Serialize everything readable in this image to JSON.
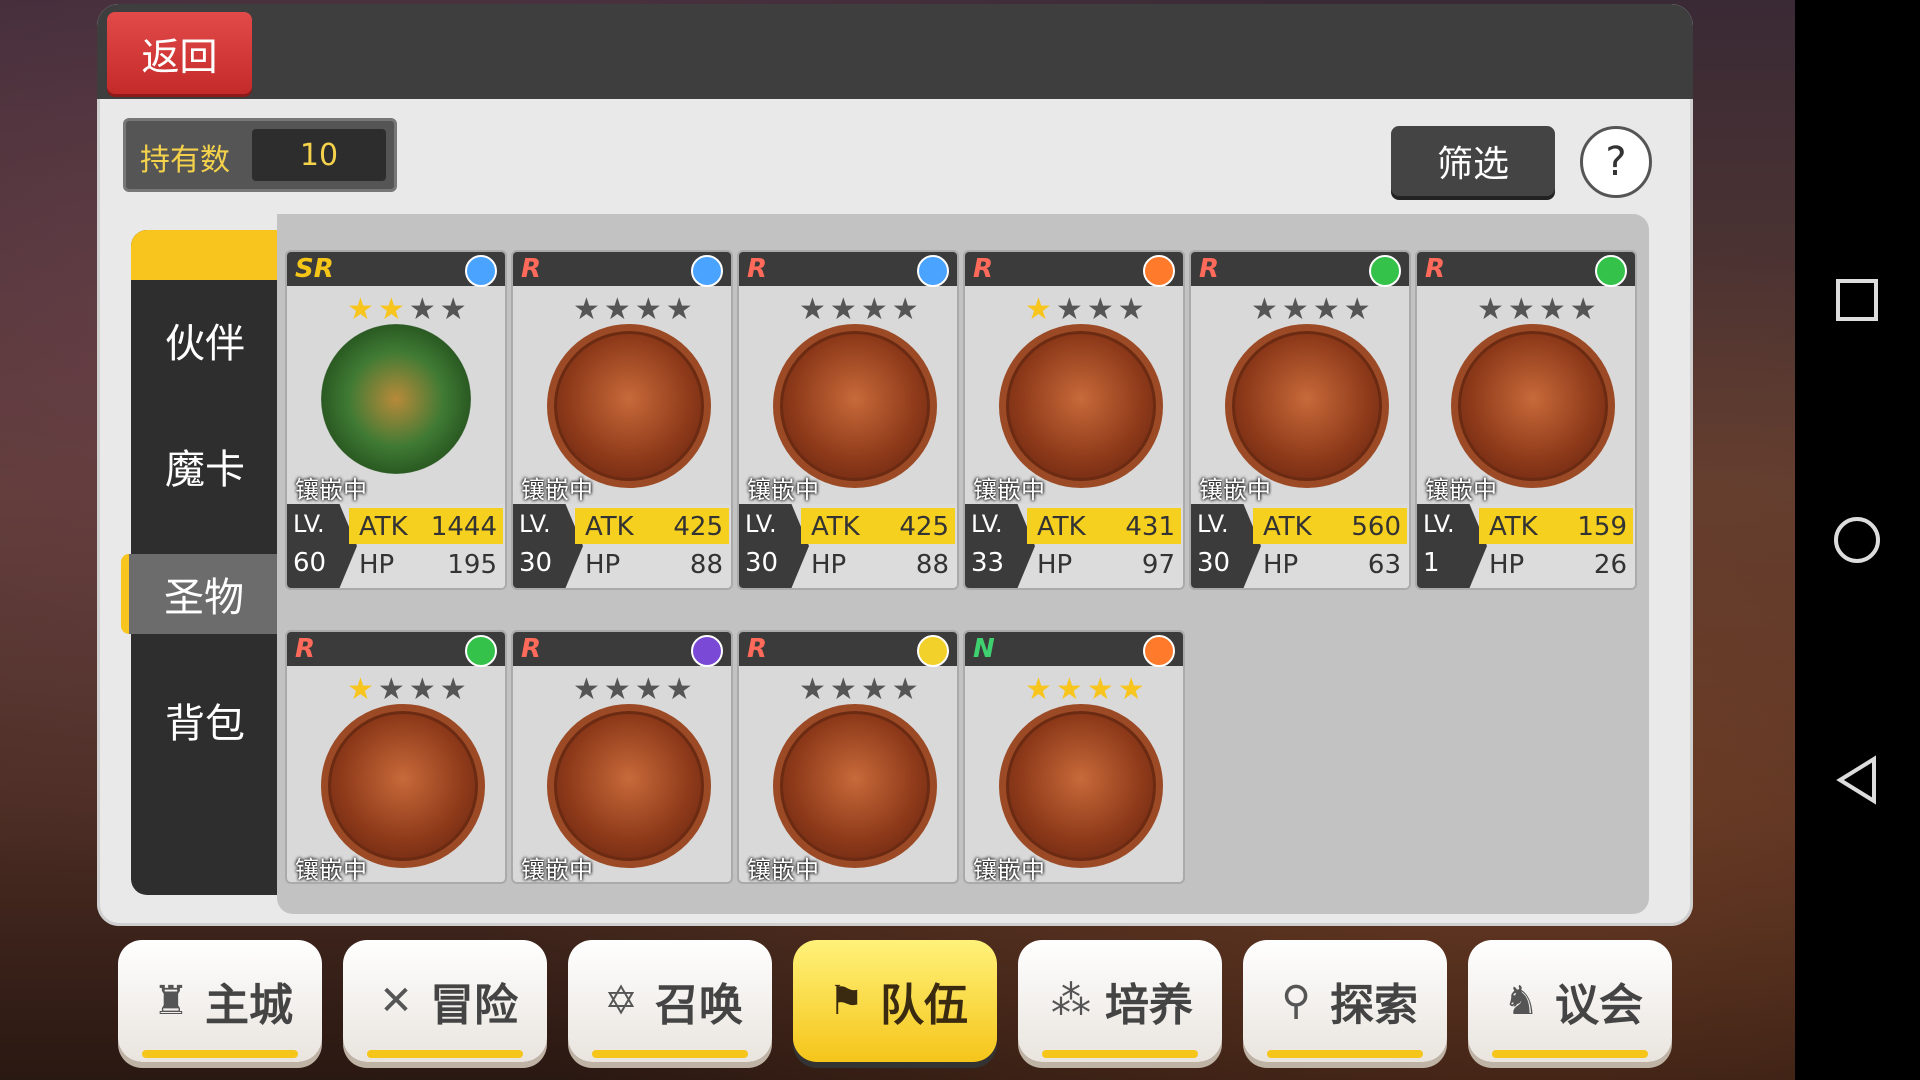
{
  "header": {
    "back_label": "返回"
  },
  "owned": {
    "label": "持有数",
    "value": "10"
  },
  "actions": {
    "filter_label": "筛选",
    "help_label": "?"
  },
  "side_tabs": [
    {
      "label": "伙伴"
    },
    {
      "label": "魔卡"
    },
    {
      "label": "圣物",
      "active": true
    },
    {
      "label": "背包"
    }
  ],
  "inlay_text": "镶嵌中",
  "stat_labels": {
    "lv": "LV.",
    "atk": "ATK",
    "hp": "HP"
  },
  "cards": [
    {
      "rarity": "SR",
      "element_color": "#4aa3ff",
      "stars": 2,
      "lv": "60",
      "atk": "1444",
      "hp": "195",
      "art": "wreath"
    },
    {
      "rarity": "R",
      "element_color": "#4aa3ff",
      "stars": 0,
      "lv": "30",
      "atk": "425",
      "hp": "88",
      "art": "medal"
    },
    {
      "rarity": "R",
      "element_color": "#4aa3ff",
      "stars": 0,
      "lv": "30",
      "atk": "425",
      "hp": "88",
      "art": "medal"
    },
    {
      "rarity": "R",
      "element_color": "#ff7a2a",
      "stars": 1,
      "lv": "33",
      "atk": "431",
      "hp": "97",
      "art": "medal"
    },
    {
      "rarity": "R",
      "element_color": "#35c24a",
      "stars": 0,
      "lv": "30",
      "atk": "560",
      "hp": "63",
      "art": "medal"
    },
    {
      "rarity": "R",
      "element_color": "#35c24a",
      "stars": 0,
      "lv": "1",
      "atk": "159",
      "hp": "26",
      "art": "medal"
    },
    {
      "rarity": "R",
      "element_color": "#35c24a",
      "stars": 1,
      "art": "medal"
    },
    {
      "rarity": "R",
      "element_color": "#7a4ad6",
      "stars": 0,
      "art": "medal"
    },
    {
      "rarity": "R",
      "element_color": "#f2d12a",
      "stars": 0,
      "art": "medal"
    },
    {
      "rarity": "N",
      "element_color": "#ff7a2a",
      "stars": 4,
      "art": "medal"
    }
  ],
  "bottom_nav": [
    {
      "label": "主城",
      "icon": "castle-icon"
    },
    {
      "label": "冒险",
      "icon": "crossed-swords-icon"
    },
    {
      "label": "召唤",
      "icon": "hexagram-icon"
    },
    {
      "label": "队伍",
      "icon": "team-icon",
      "active": true
    },
    {
      "label": "培养",
      "icon": "cultivate-icon"
    },
    {
      "label": "探索",
      "icon": "explore-icon"
    },
    {
      "label": "议会",
      "icon": "council-icon"
    }
  ]
}
